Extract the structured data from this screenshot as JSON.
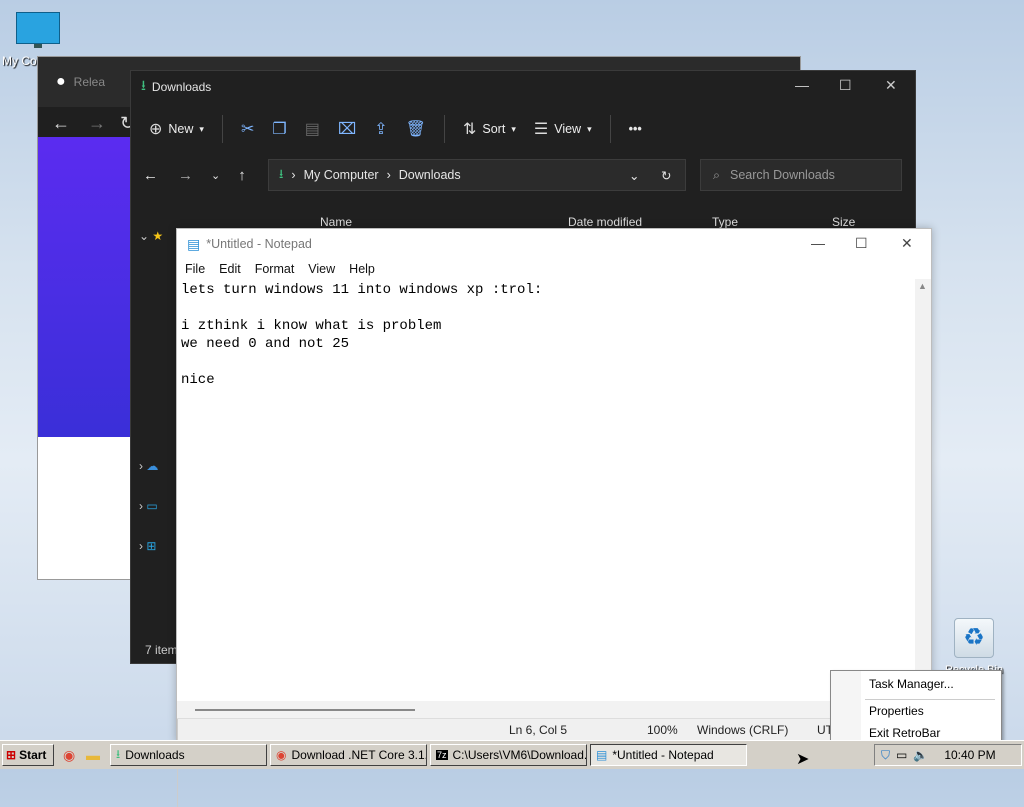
{
  "desktop": {
    "icon_mycomputer": "My Co",
    "icon_recycle": "Recycle Bin"
  },
  "back_window": {
    "tab_title": "Relea"
  },
  "explorer": {
    "title": "Downloads",
    "toolbar": {
      "new": "New",
      "sort": "Sort",
      "view": "View",
      "more": "•••"
    },
    "address": {
      "part1": "My Computer",
      "part2": "Downloads"
    },
    "search_placeholder": "Search Downloads",
    "columns": {
      "name": "Name",
      "date": "Date modified",
      "type": "Type",
      "size": "Size"
    },
    "status": "7 item"
  },
  "notepad": {
    "title": "*Untitled - Notepad",
    "menu": [
      "File",
      "Edit",
      "Format",
      "View",
      "Help"
    ],
    "content": "lets turn windows 11 into windows xp :trol:\n\ni zthink i know what is problem\nwe need 0 and not 25\n\nnice",
    "status": {
      "position": "Ln 6, Col 5",
      "zoom": "100%",
      "eol": "Windows (CRLF)",
      "encoding": "UT"
    }
  },
  "taskbar": {
    "start": "Start",
    "tasks": [
      {
        "label": "Downloads"
      },
      {
        "label": "Download .NET Core 3.1..."
      },
      {
        "label": "C:\\Users\\VM6\\Download..."
      },
      {
        "label": "*Untitled - Notepad"
      }
    ],
    "clock": "10:40 PM"
  },
  "context_menu": {
    "items": [
      "Task Manager...",
      "Properties",
      "Exit RetroBar"
    ]
  },
  "colors": {
    "explorer_bg": "#202020",
    "accent": "#3a7bd5",
    "taskbar": "#d4d0c8"
  }
}
